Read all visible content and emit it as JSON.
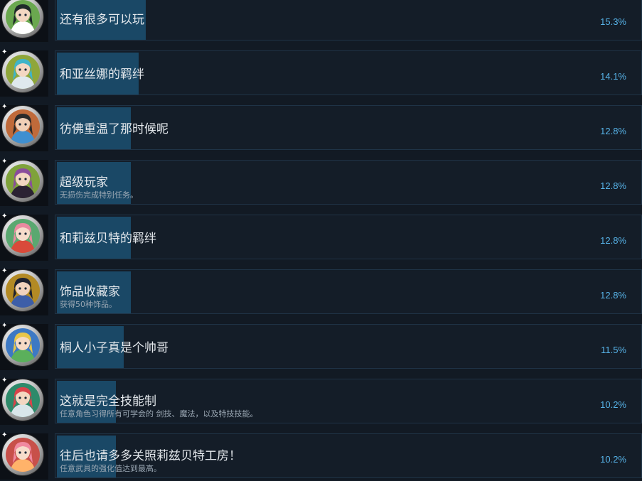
{
  "achievements": [
    {
      "name": "还有很多可以玩",
      "description": "",
      "percent": "15.3%",
      "progress": 0.153,
      "icon": "character-portrait-icon",
      "art": {
        "bg": "#6aa84f",
        "hair": "#1f2a2a",
        "skin": "#f3d7c2",
        "accent": "#ffffff"
      }
    },
    {
      "name": "和亚丝娜的羁绊",
      "description": "",
      "percent": "14.1%",
      "progress": 0.141,
      "icon": "character-portrait-icon",
      "art": {
        "bg": "#8fa63a",
        "hair": "#3fb4c9",
        "skin": "#f3d7c2",
        "accent": "#dfe9ee"
      }
    },
    {
      "name": "彷佛重温了那时候呢",
      "description": "",
      "percent": "12.8%",
      "progress": 0.128,
      "icon": "character-portrait-icon",
      "art": {
        "bg": "#c06a3a",
        "hair": "#2a2a2a",
        "skin": "#f0cfb7",
        "accent": "#3f8fd0"
      }
    },
    {
      "name": "超级玩家",
      "description": "无损伤完成特别任务。",
      "percent": "12.8%",
      "progress": 0.128,
      "icon": "character-portrait-icon",
      "art": {
        "bg": "#7fa23a",
        "hair": "#8a4d9c",
        "skin": "#f3d7c2",
        "accent": "#2b2233"
      }
    },
    {
      "name": "和莉兹贝特的羁绊",
      "description": "",
      "percent": "12.8%",
      "progress": 0.128,
      "icon": "character-portrait-icon",
      "art": {
        "bg": "#5aa870",
        "hair": "#e98aa0",
        "skin": "#f6dccb",
        "accent": "#d94a3a"
      }
    },
    {
      "name": "饰品收藏家",
      "description": "获得50种饰品。",
      "percent": "12.8%",
      "progress": 0.128,
      "icon": "character-portrait-icon",
      "art": {
        "bg": "#b38a24",
        "hair": "#1e2230",
        "skin": "#f0d2bd",
        "accent": "#3d5ea8"
      }
    },
    {
      "name": "桐人小子真是个帅哥",
      "description": "",
      "percent": "11.5%",
      "progress": 0.115,
      "icon": "character-portrait-icon",
      "art": {
        "bg": "#3d79c4",
        "hair": "#e8c64a",
        "skin": "#f5dac5",
        "accent": "#5bb05b"
      }
    },
    {
      "name": "这就是完全技能制",
      "description": "任意角色习得所有可学会的 剑技、魔法，以及特技技能。",
      "percent": "10.2%",
      "progress": 0.102,
      "icon": "character-portrait-icon",
      "art": {
        "bg": "#2e8a6a",
        "hair": "#d9434a",
        "skin": "#f3d7c2",
        "accent": "#d9e6ea"
      }
    },
    {
      "name": "往后也请多多关照莉兹贝特工房！",
      "description": "任意武具的强化值达到最高。",
      "percent": "10.2%",
      "progress": 0.102,
      "icon": "character-portrait-icon",
      "art": {
        "bg": "#c8504a",
        "hair": "#f08aa0",
        "skin": "#f6dccb",
        "accent": "#ffb36a"
      }
    }
  ]
}
